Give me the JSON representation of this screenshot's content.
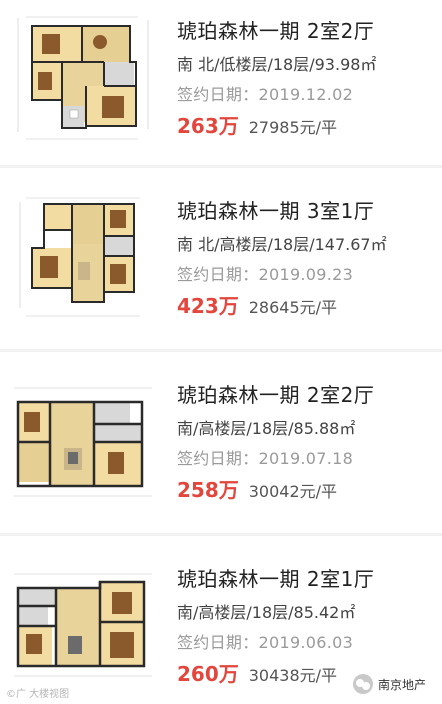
{
  "listings": [
    {
      "title": "琥珀森林一期 2室2厅",
      "meta": "南 北/低楼层/18层/93.98㎡",
      "date": "签约日期：2019.12.02",
      "price": "263万",
      "unit_price": "27985元/平",
      "floorplan_icon": "floorplan-thumbnail"
    },
    {
      "title": "琥珀森林一期 3室1厅",
      "meta": "南 北/高楼层/18层/147.67㎡",
      "date": "签约日期：2019.09.23",
      "price": "423万",
      "unit_price": "28645元/平",
      "floorplan_icon": "floorplan-thumbnail"
    },
    {
      "title": "琥珀森林一期 2室2厅",
      "meta": "南/高楼层/18层/85.88㎡",
      "date": "签约日期：2019.07.18",
      "price": "258万",
      "unit_price": "30042元/平",
      "floorplan_icon": "floorplan-thumbnail"
    },
    {
      "title": "琥珀森林一期 2室1厅",
      "meta": "南/高楼层/18层/85.42㎡",
      "date": "签约日期：2019.06.03",
      "price": "260万",
      "unit_price": "30438元/平",
      "floorplan_icon": "floorplan-thumbnail"
    }
  ],
  "watermark": "©广 大楼视图",
  "account": {
    "name": "南京地产",
    "icon": "wechat-icon"
  },
  "colors": {
    "price": "#e3463c",
    "divider": "#f2f2f2",
    "wall": "#2a2a2a",
    "room_a": "#f2dca2",
    "room_b": "#e6cf93",
    "floor_grey": "#d8d8d8",
    "furniture": "#8a5a2c"
  }
}
